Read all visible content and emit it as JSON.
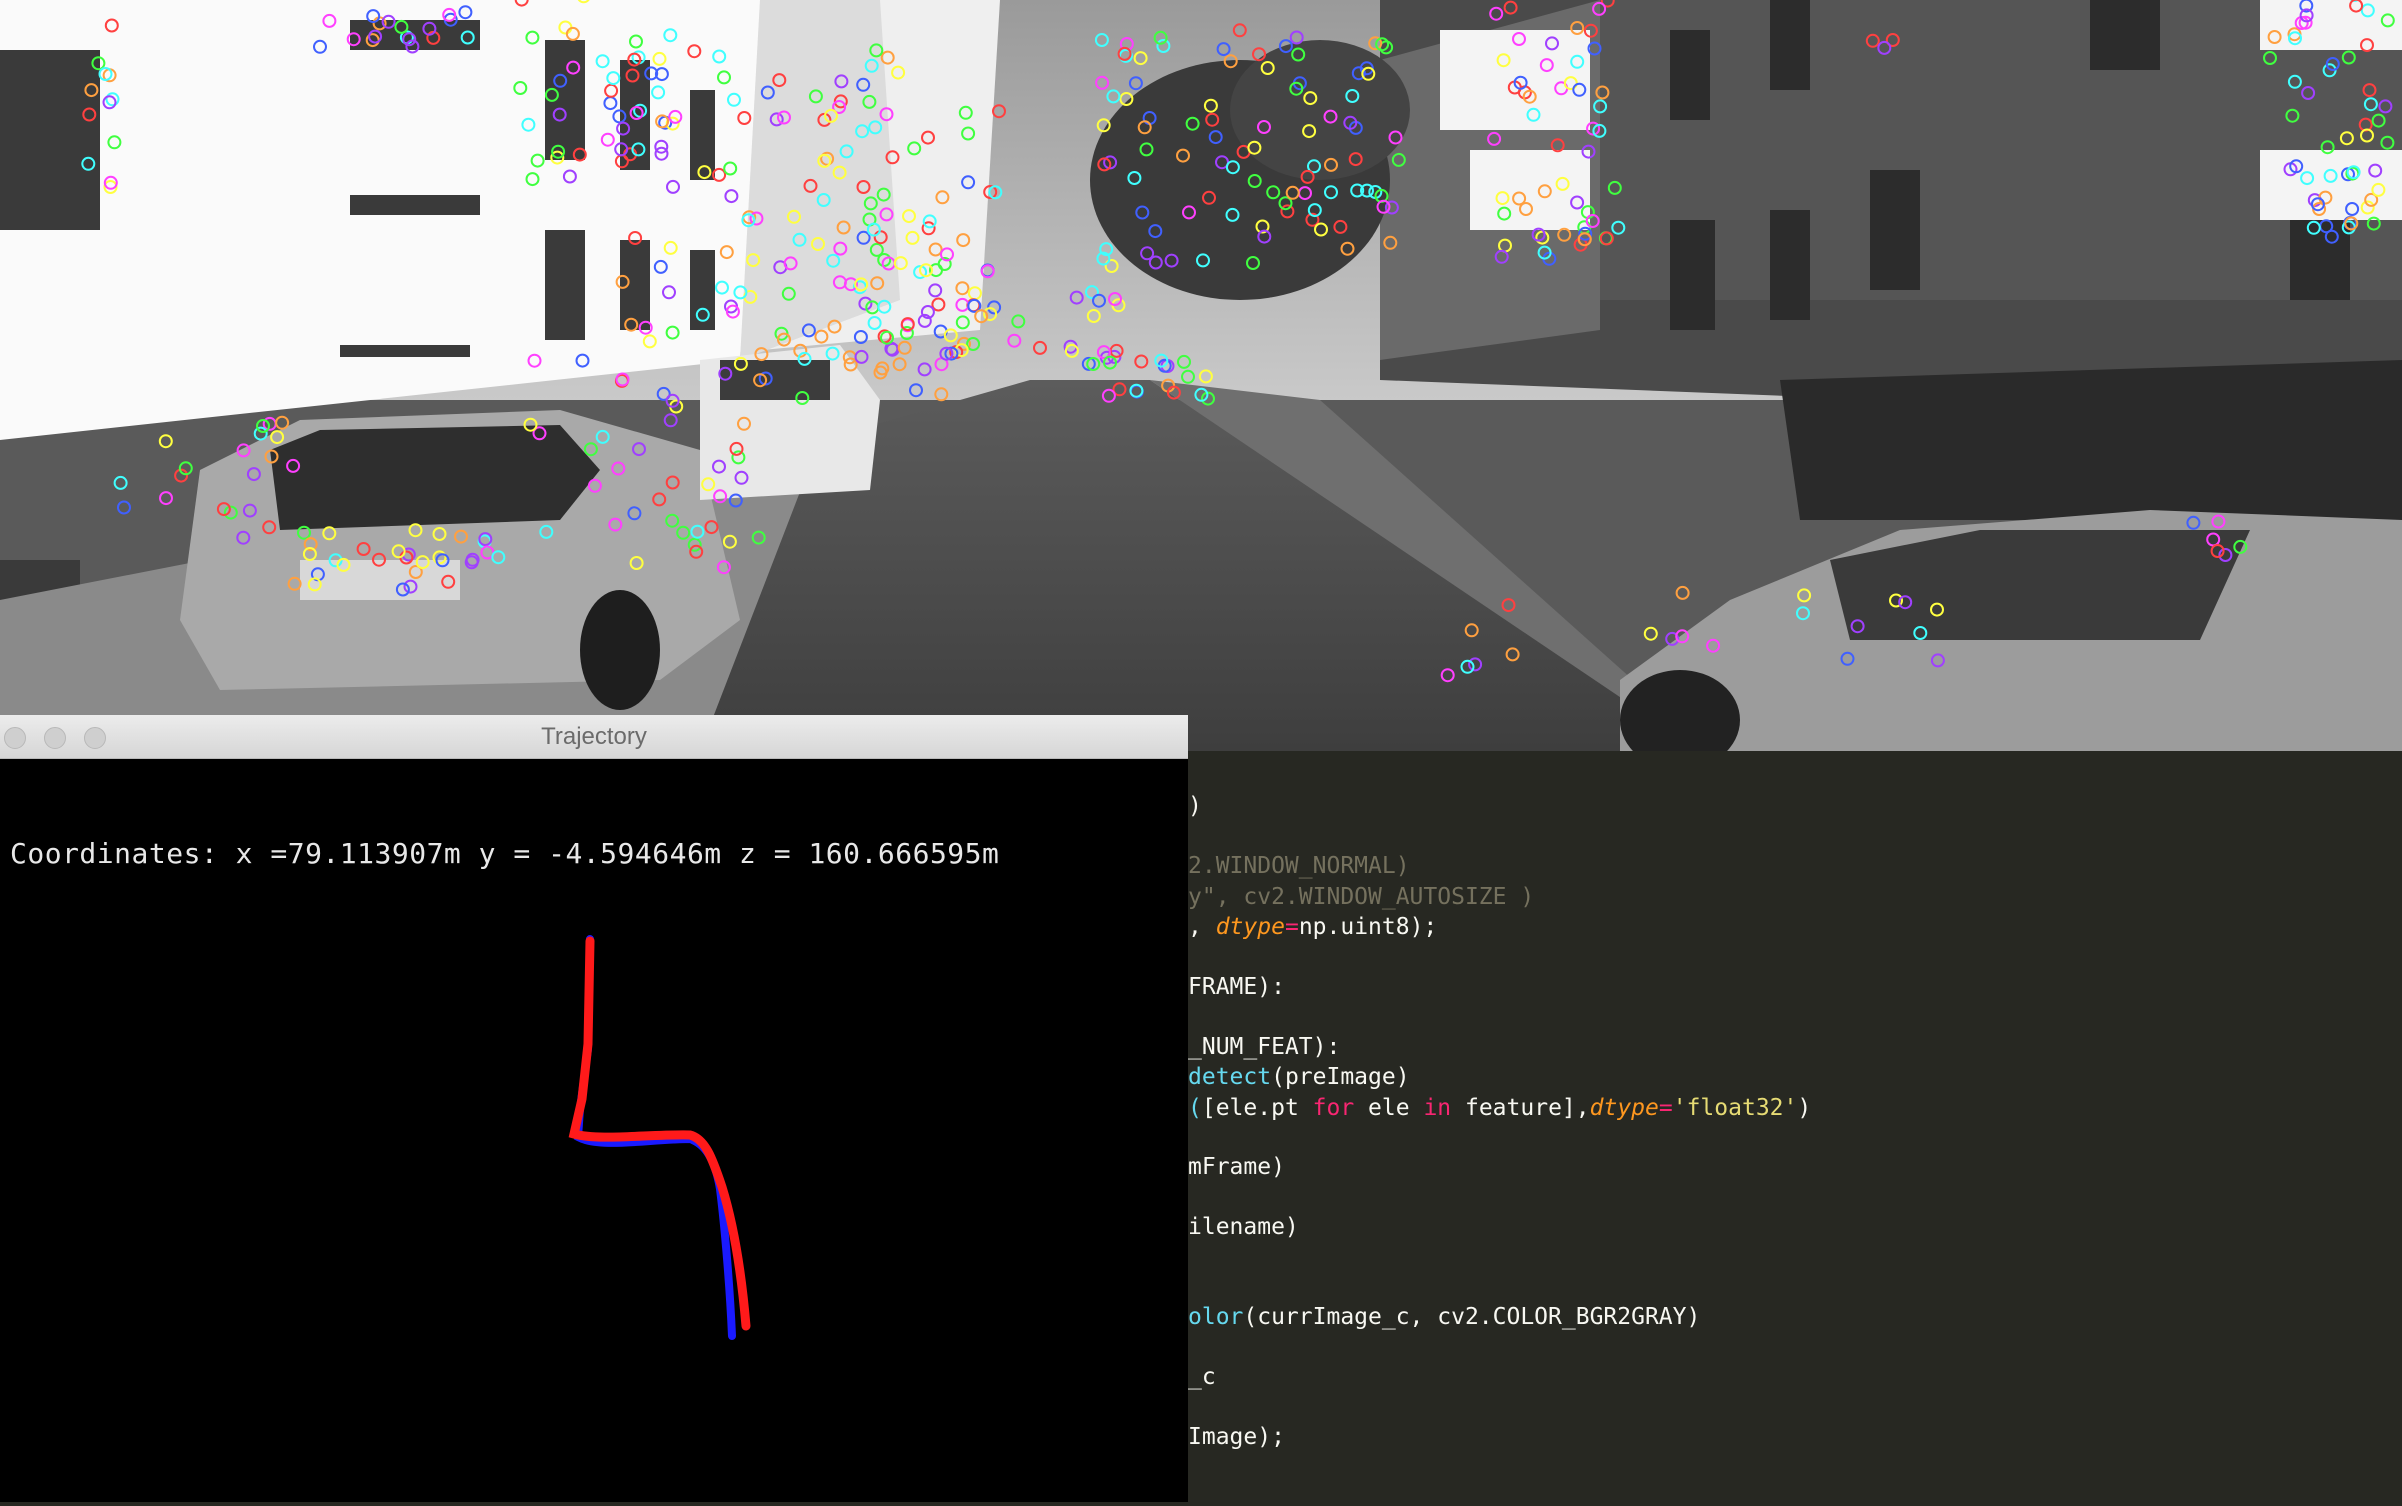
{
  "trajectory_window": {
    "title": "Trajectory",
    "coordinates_text": "Coordinates: x =79.113907m y = -4.594646m z = 160.666595m",
    "coordinates": {
      "x": "79.113907m",
      "y": "-4.594646m",
      "z": "160.666595m"
    },
    "colors": {
      "estimated_path": "#ff1a1a",
      "ground_truth_path": "#1a1aff",
      "background": "#000000"
    }
  },
  "camera_view": {
    "description_colors": [
      "#ff4040",
      "#40ff40",
      "#4060ff",
      "#ffff40",
      "#ff40ff",
      "#40ffff",
      "#ffa040",
      "#a040ff"
    ]
  },
  "editor": {
    "lines": [
      [
        {
          "t": ")"
        }
      ],
      [
        {
          "t": "2.WINDOW_NORMAL)",
          "c": "dim"
        }
      ],
      [
        {
          "t": "y\", cv2.WINDOW_AUTOSIZE )",
          "c": "dim"
        }
      ],
      [
        {
          "t": ", "
        },
        {
          "t": "dtype",
          "c": "param"
        },
        {
          "t": "=",
          "c": "kw"
        },
        {
          "t": "np.uint8);"
        }
      ],
      [
        {
          "t": "FRAME):"
        }
      ],
      [
        {
          "t": "_NUM_FEAT):"
        }
      ],
      [
        {
          "t": "detect",
          "c": "fn"
        },
        {
          "t": "(preImage)"
        }
      ],
      [
        {
          "t": "(",
          "c": "fn"
        },
        {
          "t": "[ele.pt "
        },
        {
          "t": "for",
          "c": "kw"
        },
        {
          "t": " ele "
        },
        {
          "t": "in",
          "c": "kw"
        },
        {
          "t": " feature],"
        },
        {
          "t": "dtype",
          "c": "param"
        },
        {
          "t": "=",
          "c": "kw"
        },
        {
          "t": "'float32'",
          "c": "str"
        },
        {
          "t": ")"
        }
      ],
      [
        {
          "t": "mFrame)"
        }
      ],
      [
        {
          "t": "ilename)"
        }
      ],
      [
        {
          "t": "olor",
          "c": "fn"
        },
        {
          "t": "(currImage_c, cv2.COLOR_BGR2GRAY)"
        }
      ],
      [
        {
          "t": "_c"
        }
      ],
      [
        {
          "t": "Image);"
        }
      ]
    ]
  }
}
